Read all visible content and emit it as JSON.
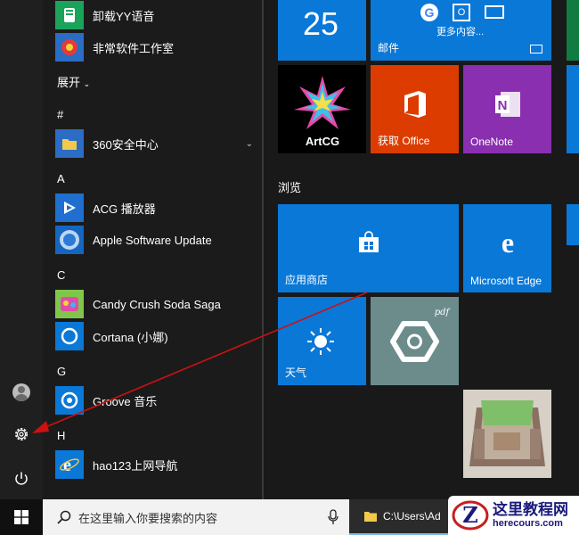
{
  "start_menu": {
    "app_list": {
      "items": [
        {
          "label": "卸载YY语音",
          "icon": "yy-voice-icon"
        },
        {
          "label": "非常软件工作室",
          "icon": "software-studio-icon"
        },
        {
          "label": "360安全中心",
          "icon": "folder-icon"
        },
        {
          "label": "ACG 播放器",
          "icon": "acg-player-icon"
        },
        {
          "label": "Apple Software Update",
          "icon": "apple-update-icon"
        },
        {
          "label": "Candy Crush Soda Saga",
          "icon": "candy-crush-icon"
        },
        {
          "label": "Cortana (小娜)",
          "icon": "cortana-icon"
        },
        {
          "label": "Groove 音乐",
          "icon": "groove-icon"
        },
        {
          "label": "hao123上网导航",
          "icon": "ie-icon"
        }
      ],
      "expand_label": "展开",
      "section_headers": [
        "#",
        "A",
        "C",
        "G",
        "H"
      ]
    },
    "rail": {
      "icons": [
        "user-avatar-icon",
        "settings-gear-icon",
        "power-icon"
      ]
    },
    "tiles": {
      "calendar_day": "25",
      "mail_more": "更多内容...",
      "mail_label": "邮件",
      "artcg_label": "ArtCG",
      "office_label": "获取 Office",
      "onenote_label": "OneNote",
      "group_browse": "浏览",
      "store_label": "应用商店",
      "edge_label": "Microsoft Edge",
      "weather_label": "天气",
      "pdf_label": "pdf"
    }
  },
  "taskbar": {
    "search_placeholder": "在这里输入你要搜索的内容",
    "explorer_title": "C:\\Users\\Ad"
  },
  "watermark": {
    "title": "这里教程网",
    "url": "herecours.com"
  },
  "colors": {
    "tile_blue": "#0a78d7",
    "office_orange": "#dc3c00",
    "onenote_purple": "#8a2fb0",
    "pdf_gray": "#6c8c8c",
    "arrow_red": "#cc1111"
  }
}
